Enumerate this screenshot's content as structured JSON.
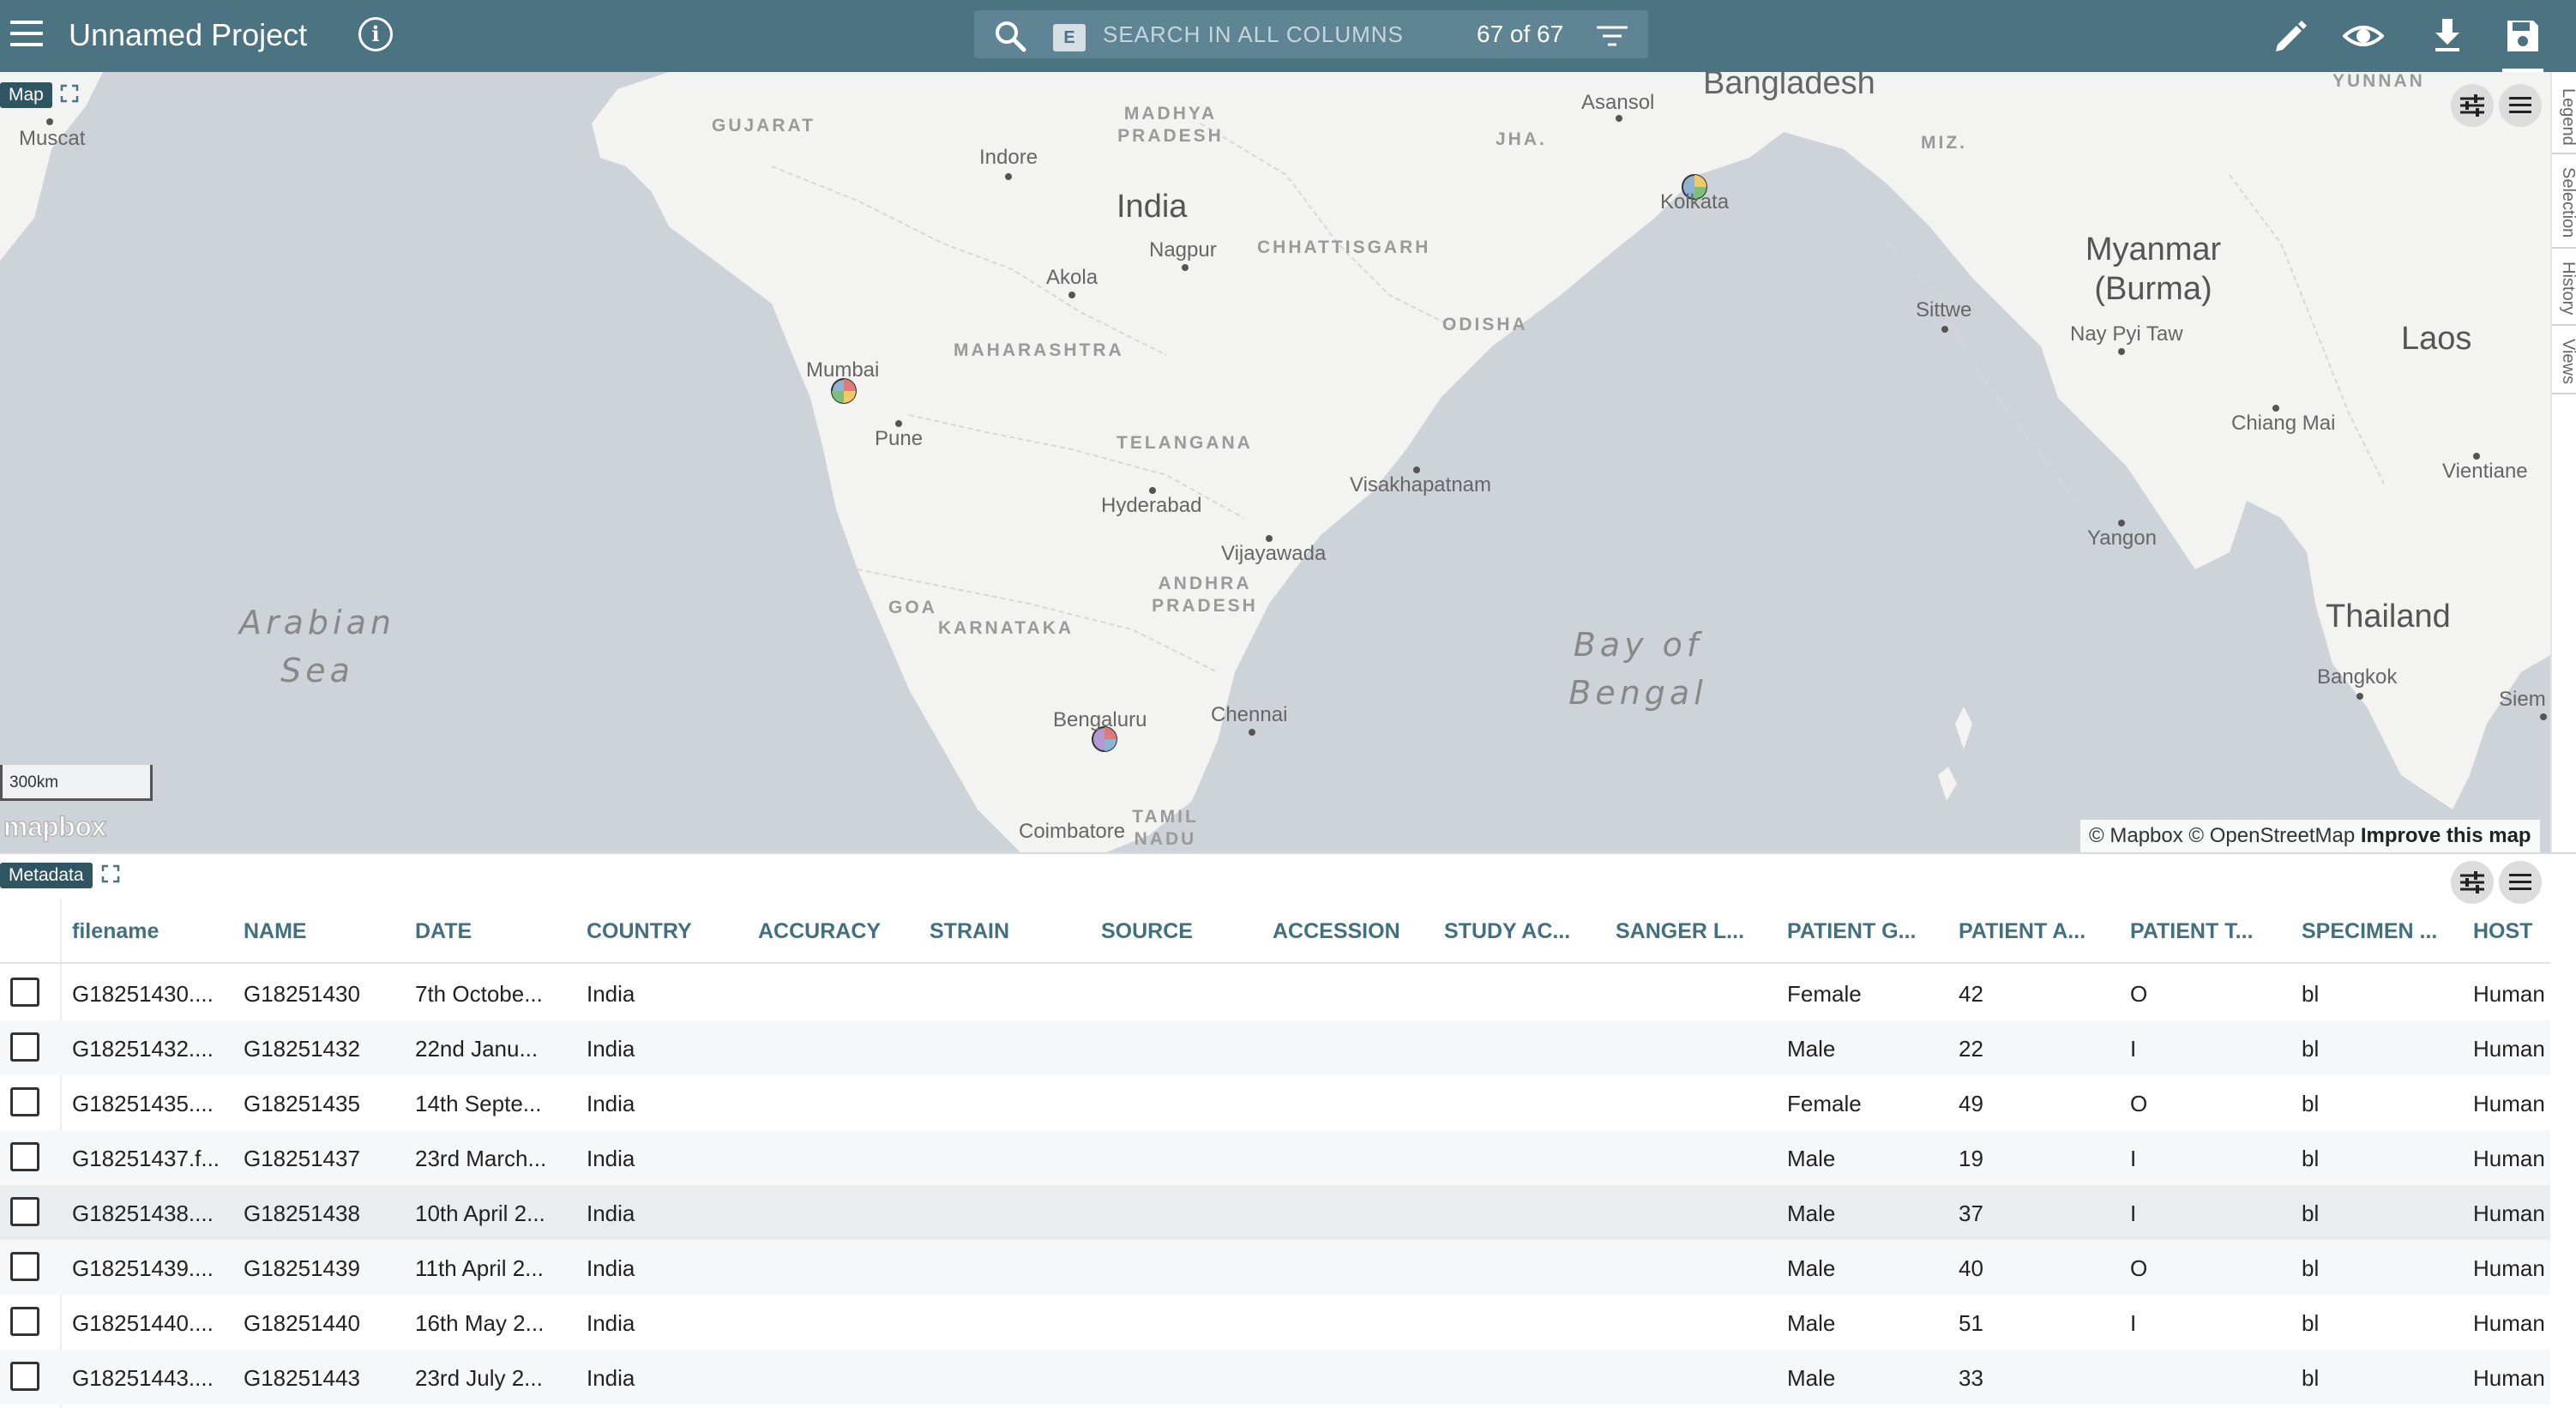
{
  "header": {
    "menu_icon": "hamburger-menu-icon",
    "title": "Unnamed Project",
    "info_icon": "info-icon",
    "search": {
      "badge": "E",
      "placeholder": "SEARCH IN ALL COLUMNS",
      "count": "67 of 67"
    },
    "tools": [
      "pencil-icon",
      "eye-icon",
      "download-icon",
      "save-icon"
    ]
  },
  "map": {
    "tag": "Map",
    "scale": "300km",
    "logo": "mapbox",
    "attribution": "© Mapbox © OpenStreetMap",
    "attribution_link": "Improve this map",
    "labels": {
      "countries": [
        "India",
        "Myanmar (Burma)",
        "Laos",
        "Thailand",
        "Bangladesh"
      ],
      "seas": [
        "Arabian Sea",
        "Bay of Bengal"
      ],
      "regions": [
        "GUJARAT",
        "MADHYA PRADESH",
        "JHA.",
        "MIZ.",
        "YUNNAN",
        "CHHATTISGARH",
        "ODISHA",
        "MAHARASHTRA",
        "TELANGANA",
        "ANDHRA PRADESH",
        "GOA",
        "KARNATAKA",
        "TAMIL NADU"
      ],
      "cities": [
        "Muscat",
        "Indore",
        "Asansol",
        "Kolkata",
        "Nagpur",
        "Akola",
        "Mumbai",
        "Pune",
        "Sittwe",
        "Nay Pyi Taw",
        "Chiang Mai",
        "Vientiane",
        "Hyderabad",
        "Vijayawada",
        "Visakhapatnam",
        "Yangon",
        "Bengaluru",
        "Chennai",
        "Coimbatore",
        "Bangkok",
        "Siem"
      ]
    }
  },
  "side_tabs": [
    "Legend",
    "Selection",
    "History",
    "Views"
  ],
  "metadata": {
    "tag": "Metadata",
    "columns": [
      "filename",
      "NAME",
      "DATE",
      "COUNTRY",
      "ACCURACY",
      "STRAIN",
      "SOURCE",
      "ACCESSION",
      "STUDY AC...",
      "SANGER L...",
      "PATIENT G...",
      "PATIENT A...",
      "PATIENT T...",
      "SPECIMEN ...",
      "HOST"
    ],
    "rows": [
      [
        "G18251430....",
        "G18251430",
        "7th Octobe...",
        "India",
        "",
        "",
        "",
        "",
        "",
        "",
        "Female",
        "42",
        "O",
        "bl",
        "Human"
      ],
      [
        "G18251432....",
        "G18251432",
        "22nd Janu...",
        "India",
        "",
        "",
        "",
        "",
        "",
        "",
        "Male",
        "22",
        "I",
        "bl",
        "Human"
      ],
      [
        "G18251435....",
        "G18251435",
        "14th Septe...",
        "India",
        "",
        "",
        "",
        "",
        "",
        "",
        "Female",
        "49",
        "O",
        "bl",
        "Human"
      ],
      [
        "G18251437.f...",
        "G18251437",
        "23rd March...",
        "India",
        "",
        "",
        "",
        "",
        "",
        "",
        "Male",
        "19",
        "I",
        "bl",
        "Human"
      ],
      [
        "G18251438....",
        "G18251438",
        "10th April 2...",
        "India",
        "",
        "",
        "",
        "",
        "",
        "",
        "Male",
        "37",
        "I",
        "bl",
        "Human"
      ],
      [
        "G18251439....",
        "G18251439",
        "11th April 2...",
        "India",
        "",
        "",
        "",
        "",
        "",
        "",
        "Male",
        "40",
        "O",
        "bl",
        "Human"
      ],
      [
        "G18251440....",
        "G18251440",
        "16th May 2...",
        "India",
        "",
        "",
        "",
        "",
        "",
        "",
        "Male",
        "51",
        "I",
        "bl",
        "Human"
      ],
      [
        "G18251443....",
        "G18251443",
        "23rd July 2...",
        "India",
        "",
        "",
        "",
        "",
        "",
        "",
        "Male",
        "33",
        "",
        "bl",
        "Human"
      ]
    ]
  },
  "colors": {
    "header_bg": "#4b7382",
    "tag_bg": "#2f5562",
    "column_text": "#43707f",
    "sea": "#cdd3d8",
    "land": "#f3f3f1"
  }
}
